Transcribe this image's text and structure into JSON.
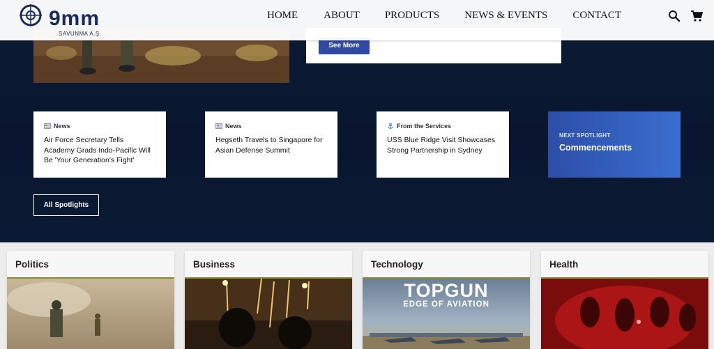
{
  "brand": {
    "logo_text": "9mm",
    "logo_sub": "SAVUNMA A.Ş."
  },
  "nav": {
    "items": [
      "HOME",
      "ABOUT",
      "PRODUCTS",
      "NEWS & EVENTS",
      "CONTACT"
    ]
  },
  "header_icons": [
    "search-icon",
    "cart-icon"
  ],
  "hero": {
    "see_more_label": "See More"
  },
  "news_cards": [
    {
      "tag": "News",
      "tag_icon": "newspaper-icon",
      "title": "Air Force Secretary Tells Academy Grads Indo-Pacific Will Be 'Your Generation's Fight'"
    },
    {
      "tag": "News",
      "tag_icon": "newspaper-icon",
      "title": "Hegseth Travels to Singapore for Asian Defense Summit"
    },
    {
      "tag": "From the Services",
      "tag_icon": "anchor-icon",
      "title": "USS Blue Ridge Visit Showcases Strong Partnership in Sydney"
    }
  ],
  "spotlight": {
    "kicker": "NEXT SPOTLIGHT",
    "name": "Commencements",
    "all_label": "All Spotlights"
  },
  "categories": [
    {
      "label": "Politics"
    },
    {
      "label": "Business"
    },
    {
      "label": "Technology",
      "image_title": "TOPGUN",
      "image_subtitle": "EDGE OF AVIATION"
    },
    {
      "label": "Health"
    }
  ],
  "colors": {
    "hero_bg": "#0a1630",
    "accent_blue": "#2f4aa0",
    "spotlight_gradient_start": "#2d4ea8",
    "spotlight_gradient_end": "#3a6ed0",
    "category_underline": "#8a8a3a"
  }
}
